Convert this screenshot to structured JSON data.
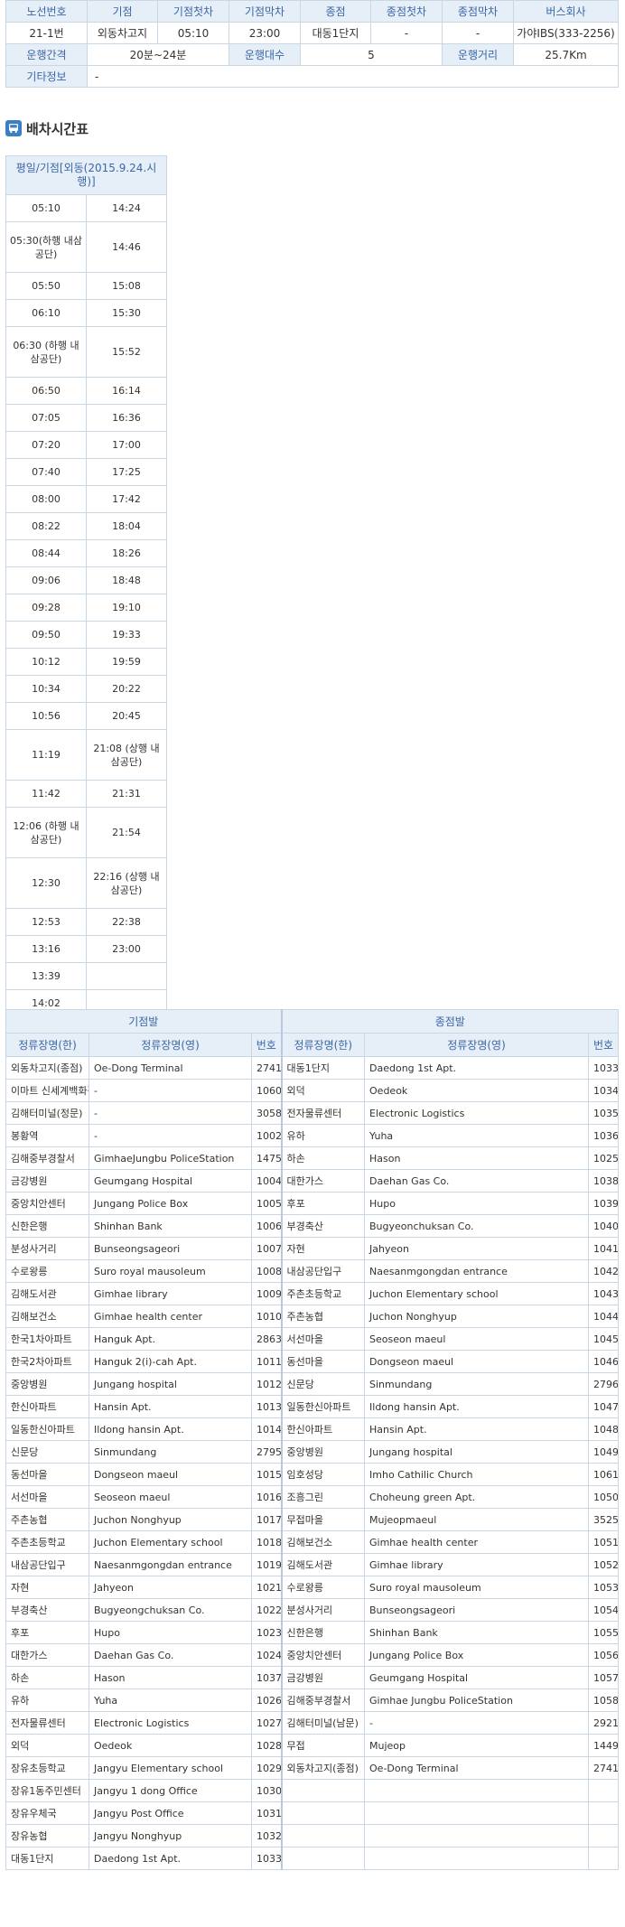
{
  "route_info": {
    "headers": [
      "노선번호",
      "기점",
      "기점첫차",
      "기점막차",
      "종점",
      "종점첫차",
      "종점막차",
      "버스회사"
    ],
    "values": [
      "21-1번",
      "외동차고지",
      "05:10",
      "23:00",
      "대동1단지",
      "-",
      "-",
      "가야IBS(333-2256)"
    ],
    "interval_label": "운행간격",
    "interval_value": "20분~24분",
    "count_label": "운행대수",
    "count_value": "5",
    "distance_label": "운행거리",
    "distance_value": "25.7Km",
    "etc_label": "기타정보",
    "etc_value": "-"
  },
  "timetable": {
    "title": "배차시간표",
    "column_header": "평일/기점[외동(2015.9.24.시행)]",
    "rows": [
      [
        "05:10",
        "14:24"
      ],
      [
        "05:30(하행 내삼공단)",
        "14:46"
      ],
      [
        "05:50",
        "15:08"
      ],
      [
        "06:10",
        "15:30"
      ],
      [
        "06:30 (하행 내삼공단)",
        "15:52"
      ],
      [
        "06:50",
        "16:14"
      ],
      [
        "07:05",
        "16:36"
      ],
      [
        "07:20",
        "17:00"
      ],
      [
        "07:40",
        "17:25"
      ],
      [
        "08:00",
        "17:42"
      ],
      [
        "08:22",
        "18:04"
      ],
      [
        "08:44",
        "18:26"
      ],
      [
        "09:06",
        "18:48"
      ],
      [
        "09:28",
        "19:10"
      ],
      [
        "09:50",
        "19:33"
      ],
      [
        "10:12",
        "19:59"
      ],
      [
        "10:34",
        "20:22"
      ],
      [
        "10:56",
        "20:45"
      ],
      [
        "11:19",
        "21:08 (상행 내삼공단)"
      ],
      [
        "11:42",
        "21:31"
      ],
      [
        "12:06 (하행 내삼공단)",
        "21:54"
      ],
      [
        "12:30",
        "22:16 (상행 내삼공단)"
      ],
      [
        "12:53",
        "22:38"
      ],
      [
        "13:16",
        "23:00"
      ],
      [
        "13:39",
        ""
      ],
      [
        "14:02",
        ""
      ]
    ]
  },
  "stops": {
    "start_header": "기점발",
    "end_header": "종점발",
    "col_name_kr": "정류장명(한)",
    "col_name_en": "정류장명(영)",
    "col_num": "번호",
    "rows": [
      [
        "외동차고지(종점)",
        "Oe-Dong Terminal",
        "2741",
        "대동1단지",
        "Daedong 1st Apt.",
        "1033"
      ],
      [
        "이마트 신세계백화점",
        "-",
        "1060",
        "외덕",
        "Oedeok",
        "1034"
      ],
      [
        "김해터미널(정문)",
        "-",
        "3058",
        "전자물류센터",
        "Electronic Logistics",
        "1035"
      ],
      [
        "봉황역",
        "-",
        "1002",
        "유하",
        "Yuha",
        "1036"
      ],
      [
        "김해중부경찰서",
        "GimhaeJungbu PoliceStation",
        "1475",
        "하손",
        "Hason",
        "1025"
      ],
      [
        "금강병원",
        "Geumgang Hospital",
        "1004",
        "대한가스",
        "Daehan Gas Co.",
        "1038"
      ],
      [
        "중앙치안센터",
        "Jungang Police Box",
        "1005",
        "후포",
        "Hupo",
        "1039"
      ],
      [
        "신한은행",
        "Shinhan Bank",
        "1006",
        "부경축산",
        "Bugyeonchuksan Co.",
        "1040"
      ],
      [
        "분성사거리",
        "Bunseongsageori",
        "1007",
        "자현",
        "Jahyeon",
        "1041"
      ],
      [
        "수로왕릉",
        "Suro royal mausoleum",
        "1008",
        "내삼공단입구",
        "Naesanmgongdan entrance",
        "1042"
      ],
      [
        "김해도서관",
        "Gimhae library",
        "1009",
        "주촌초등학교",
        "Juchon Elementary school",
        "1043"
      ],
      [
        "김해보건소",
        "Gimhae health center",
        "1010",
        "주촌농협",
        "Juchon Nonghyup",
        "1044"
      ],
      [
        "한국1차아파트",
        "Hanguk Apt.",
        "2863",
        "서선마을",
        "Seoseon maeul",
        "1045"
      ],
      [
        "한국2차아파트",
        "Hanguk 2(i)-cah Apt.",
        "1011",
        "동선마을",
        "Dongseon maeul",
        "1046"
      ],
      [
        "중앙병원",
        "Jungang hospital",
        "1012",
        "신문당",
        "Sinmundang",
        "2796"
      ],
      [
        "한신아파트",
        "Hansin Apt.",
        "1013",
        "일동한신아파트",
        "Ildong hansin Apt.",
        "1047"
      ],
      [
        "일동한신아파트",
        "Ildong hansin Apt.",
        "1014",
        "한신아파트",
        "Hansin Apt.",
        "1048"
      ],
      [
        "신문당",
        "Sinmundang",
        "2795",
        "중앙병원",
        "Jungang hospital",
        "1049"
      ],
      [
        "동선마을",
        "Dongseon maeul",
        "1015",
        "임호성당",
        "Imho Cathilic Church",
        "1061"
      ],
      [
        "서선마을",
        "Seoseon maeul",
        "1016",
        "조흥그린",
        "Choheung green Apt.",
        "1050"
      ],
      [
        "주촌농협",
        "Juchon Nonghyup",
        "1017",
        "무접마을",
        "Mujeopmaeul",
        "3525"
      ],
      [
        "주촌초등학교",
        "Juchon Elementary school",
        "1018",
        "김해보건소",
        "Gimhae health center",
        "1051"
      ],
      [
        "내삼공단입구",
        "Naesanmgongdan entrance",
        "1019",
        "김해도서관",
        "Gimhae library",
        "1052"
      ],
      [
        "자현",
        "Jahyeon",
        "1021",
        "수로왕릉",
        "Suro royal mausoleum",
        "1053"
      ],
      [
        "부경축산",
        "Bugyeongchuksan Co.",
        "1022",
        "분성사거리",
        "Bunseongsageori",
        "1054"
      ],
      [
        "후포",
        "Hupo",
        "1023",
        "신한은행",
        "Shinhan Bank",
        "1055"
      ],
      [
        "대한가스",
        "Daehan Gas Co.",
        "1024",
        "중앙치안센터",
        "Jungang Police Box",
        "1056"
      ],
      [
        "하손",
        "Hason",
        "1037",
        "금강병원",
        "Geumgang Hospital",
        "1057"
      ],
      [
        "유하",
        "Yuha",
        "1026",
        "김해중부경찰서",
        "Gimhae Jungbu PoliceStation",
        "1058"
      ],
      [
        "전자물류센터",
        "Electronic Logistics",
        "1027",
        "김해터미널(남문)",
        "-",
        "2921"
      ],
      [
        "외덕",
        "Oedeok",
        "1028",
        "무접",
        "Mujeop",
        "1449"
      ],
      [
        "장유초등학교",
        "Jangyu Elementary school",
        "1029",
        "외동차고지(종점)",
        "Oe-Dong Terminal",
        "2741"
      ],
      [
        "장유1동주민센터",
        "Jangyu 1 dong Office",
        "1030",
        "",
        "",
        ""
      ],
      [
        "장유우체국",
        "Jangyu Post Office",
        "1031",
        "",
        "",
        ""
      ],
      [
        "장유농협",
        "Jangyu Nonghyup",
        "1032",
        "",
        "",
        ""
      ],
      [
        "대동1단지",
        "Daedong 1st Apt.",
        "1033",
        "",
        "",
        ""
      ]
    ]
  }
}
